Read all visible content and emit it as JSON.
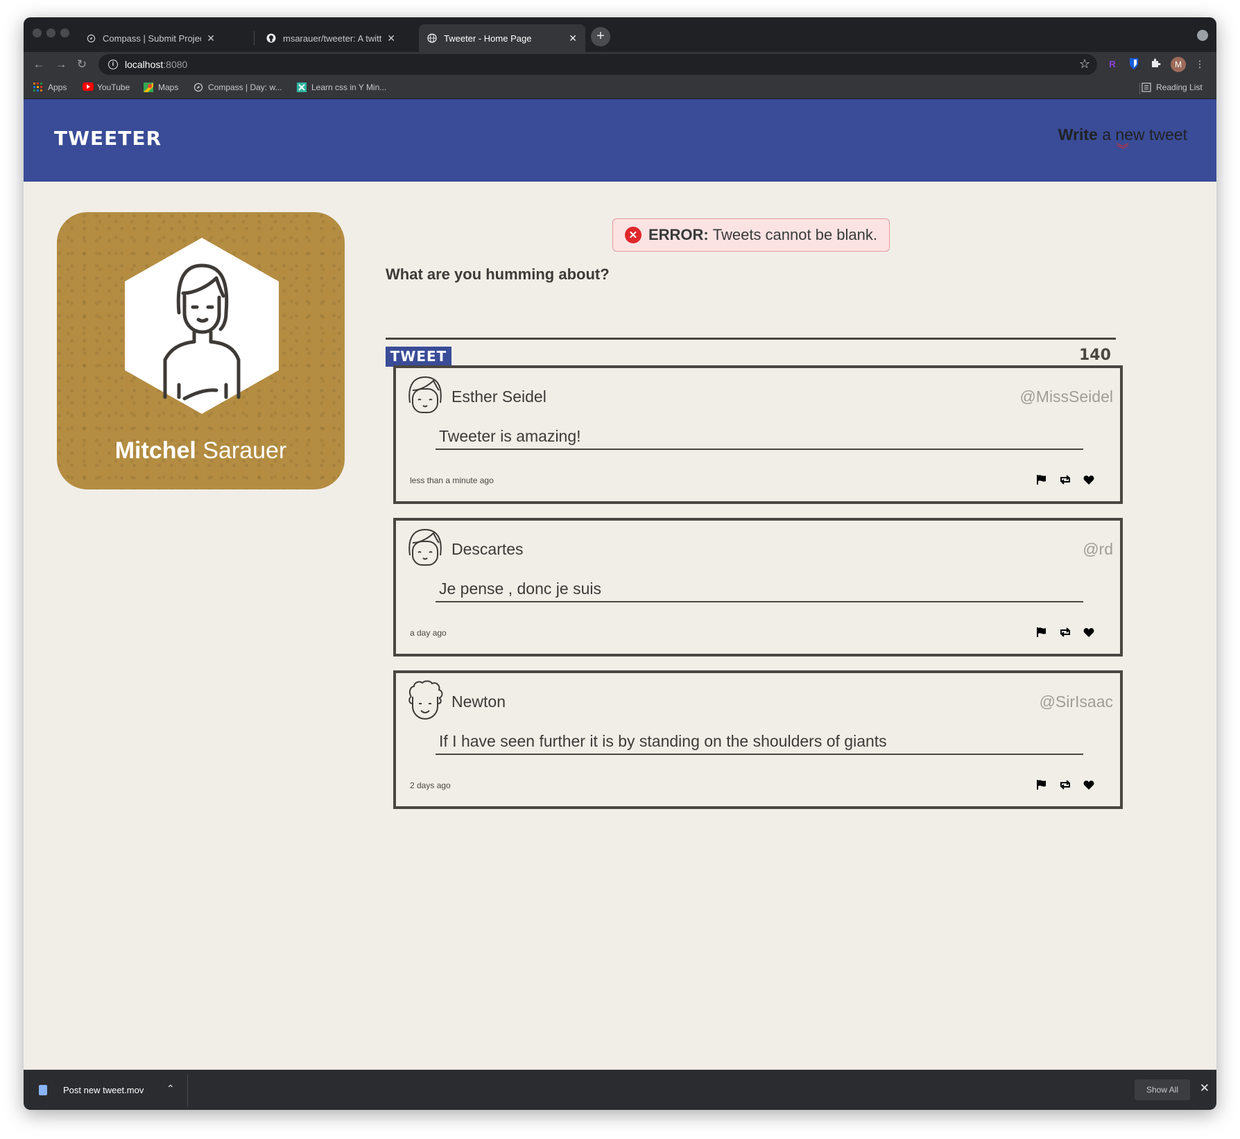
{
  "browser": {
    "tabs": [
      {
        "title": "Compass | Submit Project for E",
        "active": false
      },
      {
        "title": "msarauer/tweeter: A twitter clo",
        "active": false
      },
      {
        "title": "Tweeter - Home Page",
        "active": true
      }
    ],
    "url_host": "localhost",
    "url_port": ":8080",
    "bookmarks": [
      "Apps",
      "YouTube",
      "Maps",
      "Compass | Day: w...",
      "Learn css in Y Min..."
    ],
    "reading_list": "Reading List",
    "profile_initial": "M",
    "ext_r": "R"
  },
  "header": {
    "brand": "TWEETER",
    "write_bold": "Write",
    "write_rest": " a new tweet",
    "chevron": "︾"
  },
  "profile": {
    "first_name": "Mitchel",
    "last_name": " Sarauer"
  },
  "compose": {
    "error_label": "ERROR:",
    "error_text": "Tweets cannot be blank.",
    "prompt": "What are you humming about?",
    "button_label": "TWEET",
    "counter": "140"
  },
  "tweets": [
    {
      "name": "Esther Seidel",
      "handle": "@MissSeidel",
      "content": "Tweeter is amazing!",
      "time": "less than a minute ago",
      "avatar": "girl-avatar-icon"
    },
    {
      "name": "Descartes",
      "handle": "@rd",
      "content": "Je pense , donc je suis",
      "time": "a day ago",
      "avatar": "girl-avatar-icon"
    },
    {
      "name": "Newton",
      "handle": "@SirIsaac",
      "content": "If I have seen further it is by standing on the shoulders of giants",
      "time": "2 days ago",
      "avatar": "boy-avatar-icon"
    }
  ],
  "downloads": {
    "file": "Post new tweet.mov",
    "show_all": "Show All"
  },
  "colors": {
    "header_blue": "#3a4c97",
    "page_bg": "#f1eee8",
    "profile_gold": "#b48d42",
    "error_red": "#e0262b"
  }
}
